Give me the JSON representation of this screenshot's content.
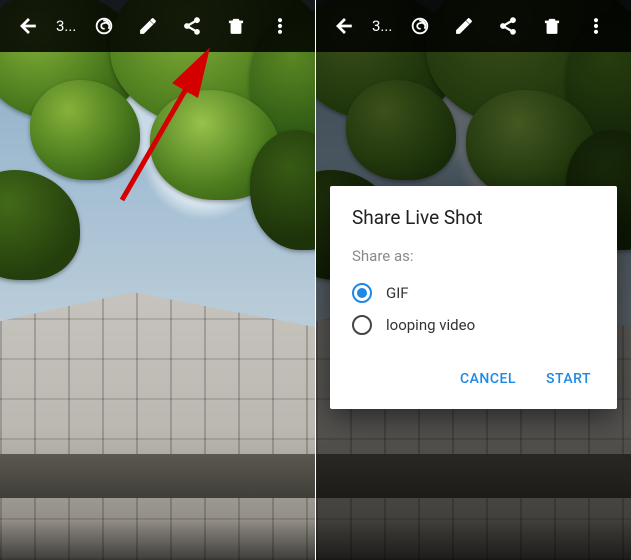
{
  "toolbar": {
    "counter_text": "3...",
    "back_label": "Back",
    "auto_enhance_label": "Auto enhance",
    "edit_label": "Edit",
    "share_label": "Share",
    "delete_label": "Delete",
    "overflow_label": "More options"
  },
  "dialog": {
    "title": "Share Live Shot",
    "subtitle": "Share as:",
    "options": [
      {
        "label": "GIF",
        "selected": true
      },
      {
        "label": "looping video",
        "selected": false
      }
    ],
    "cancel": "CANCEL",
    "start": "START"
  },
  "colors": {
    "accent": "#1e88e5",
    "annotation_arrow": "#d40000"
  }
}
